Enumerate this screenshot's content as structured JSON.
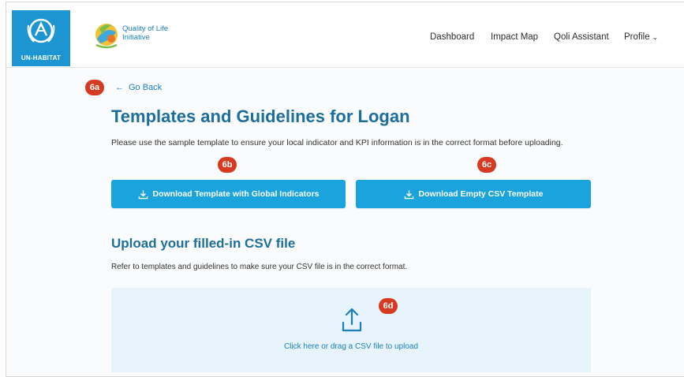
{
  "brand": {
    "unhabitat_label": "UN-HABITAT",
    "qol_line1": "Quality of Life",
    "qol_line2": "Initiative"
  },
  "nav": {
    "items": [
      {
        "label": "Dashboard"
      },
      {
        "label": "Impact Map"
      },
      {
        "label": "Qoli Assistant"
      },
      {
        "label": "Profile"
      }
    ]
  },
  "annotations": {
    "a": "6a",
    "b": "6b",
    "c": "6c",
    "d": "6d"
  },
  "back": {
    "label": "Go Back"
  },
  "main": {
    "title": "Templates and Guidelines for Logan",
    "description": "Please use the sample template to ensure your local indicator and KPI information is in the correct format before uploading.",
    "buttons": {
      "global": "Download Template with Global Indicators",
      "empty": "Download Empty CSV Template"
    },
    "upload_title": "Upload your filled-in CSV file",
    "upload_description": "Refer to templates and guidelines to make sure your CSV file is in the correct format.",
    "dropzone_text": "Click here or drag a CSV file to upload"
  },
  "icons": {
    "back": "arrow-left-icon",
    "download": "download-icon",
    "upload": "upload-icon",
    "profile_menu": "chevron-down-icon"
  },
  "colors": {
    "brand_blue": "#1c95d2",
    "button_blue": "#1ba3de",
    "title_blue": "#1d6f99",
    "badge_red": "#d63b22",
    "dropzone_bg": "#e8f4fc"
  }
}
